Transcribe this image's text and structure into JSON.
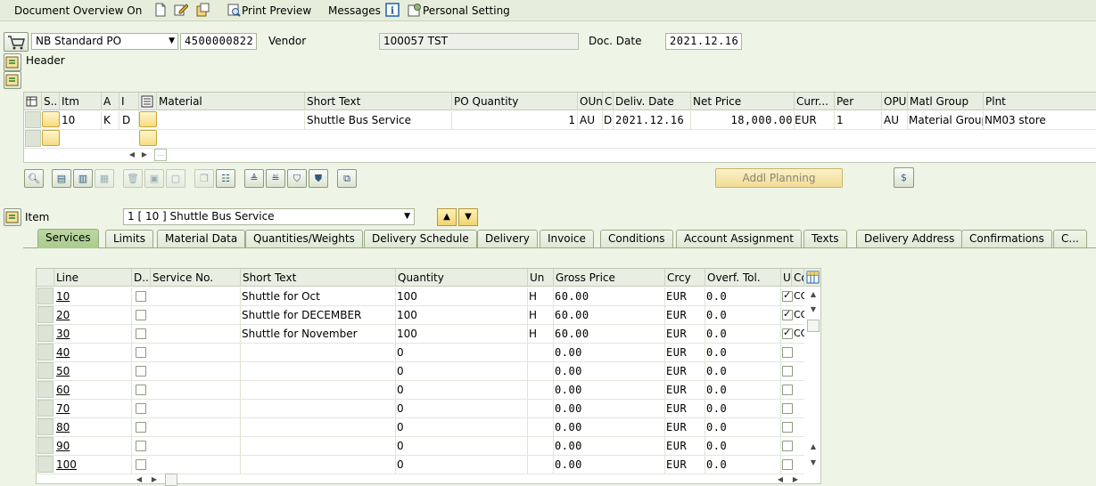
{
  "toolbar": {
    "doc_overview": "Document Overview On",
    "print_preview": "Print Preview",
    "messages": "Messages",
    "personal_setting": "Personal Setting"
  },
  "header": {
    "po_type": "NB Standard PO",
    "po_number": "4500000822",
    "vendor_label": "Vendor",
    "vendor_value": "100057 TST",
    "doc_date_label": "Doc. Date",
    "doc_date_value": "2021.12.16",
    "header_label": "Header"
  },
  "item_grid": {
    "columns": [
      "S..",
      "Itm",
      "A",
      "I",
      "",
      "Material",
      "Short Text",
      "PO Quantity",
      "OUn",
      "C",
      "Deliv. Date",
      "Net Price",
      "Curr...",
      "Per",
      "OPU",
      "Matl Group",
      "Plnt"
    ],
    "row1": {
      "itm": "10",
      "a": "K",
      "i": "D",
      "material": "",
      "short_text": "Shuttle Bus Service",
      "po_quantity": "1",
      "oun": "AU",
      "c": "D",
      "deliv_date": "2021.12.16",
      "net_price": "18,000.00",
      "curr": "EUR",
      "per": "1",
      "opu": "AU",
      "matl_group": "Material Group...",
      "plnt": "NM03 store"
    }
  },
  "addl_planning": "Addl Planning",
  "item_section": {
    "label": "Item",
    "selected": "1 [ 10 ] Shuttle Bus Service"
  },
  "tabs": [
    "Services",
    "Limits",
    "Material Data",
    "Quantities/Weights",
    "Delivery Schedule",
    "Delivery",
    "Invoice",
    "Conditions",
    "Account Assignment",
    "Texts",
    "Delivery Address",
    "Confirmations",
    "C..."
  ],
  "services_grid": {
    "columns": [
      "Line",
      "D..",
      "Service No.",
      "Short Text",
      "Quantity",
      "Un",
      "Gross Price",
      "Crcy",
      "Overf. Tol.",
      "U",
      "Co"
    ],
    "rows": [
      {
        "line": "10",
        "short_text": "Shuttle for Oct",
        "quantity": "100",
        "un": "H",
        "gross_price": "60.00",
        "crcy": "EUR",
        "overf": "0.0",
        "u": true,
        "co": "CO"
      },
      {
        "line": "20",
        "short_text": "Shuttle for DECEMBER",
        "quantity": "100",
        "un": "H",
        "gross_price": "60.00",
        "crcy": "EUR",
        "overf": "0.0",
        "u": true,
        "co": "CO"
      },
      {
        "line": "30",
        "short_text": "Shuttle for November",
        "quantity": "100",
        "un": "H",
        "gross_price": "60.00",
        "crcy": "EUR",
        "overf": "0.0",
        "u": true,
        "co": "CO"
      },
      {
        "line": "40",
        "short_text": "",
        "quantity": "0",
        "un": "",
        "gross_price": "0.00",
        "crcy": "EUR",
        "overf": "0.0",
        "u": false,
        "co": ""
      },
      {
        "line": "50",
        "short_text": "",
        "quantity": "0",
        "un": "",
        "gross_price": "0.00",
        "crcy": "EUR",
        "overf": "0.0",
        "u": false,
        "co": ""
      },
      {
        "line": "60",
        "short_text": "",
        "quantity": "0",
        "un": "",
        "gross_price": "0.00",
        "crcy": "EUR",
        "overf": "0.0",
        "u": false,
        "co": ""
      },
      {
        "line": "70",
        "short_text": "",
        "quantity": "0",
        "un": "",
        "gross_price": "0.00",
        "crcy": "EUR",
        "overf": "0.0",
        "u": false,
        "co": ""
      },
      {
        "line": "80",
        "short_text": "",
        "quantity": "0",
        "un": "",
        "gross_price": "0.00",
        "crcy": "EUR",
        "overf": "0.0",
        "u": false,
        "co": ""
      },
      {
        "line": "90",
        "short_text": "",
        "quantity": "0",
        "un": "",
        "gross_price": "0.00",
        "crcy": "EUR",
        "overf": "0.0",
        "u": false,
        "co": ""
      },
      {
        "line": "100",
        "short_text": "",
        "quantity": "0",
        "un": "",
        "gross_price": "0.00",
        "crcy": "EUR",
        "overf": "0.0",
        "u": false,
        "co": ""
      }
    ]
  }
}
